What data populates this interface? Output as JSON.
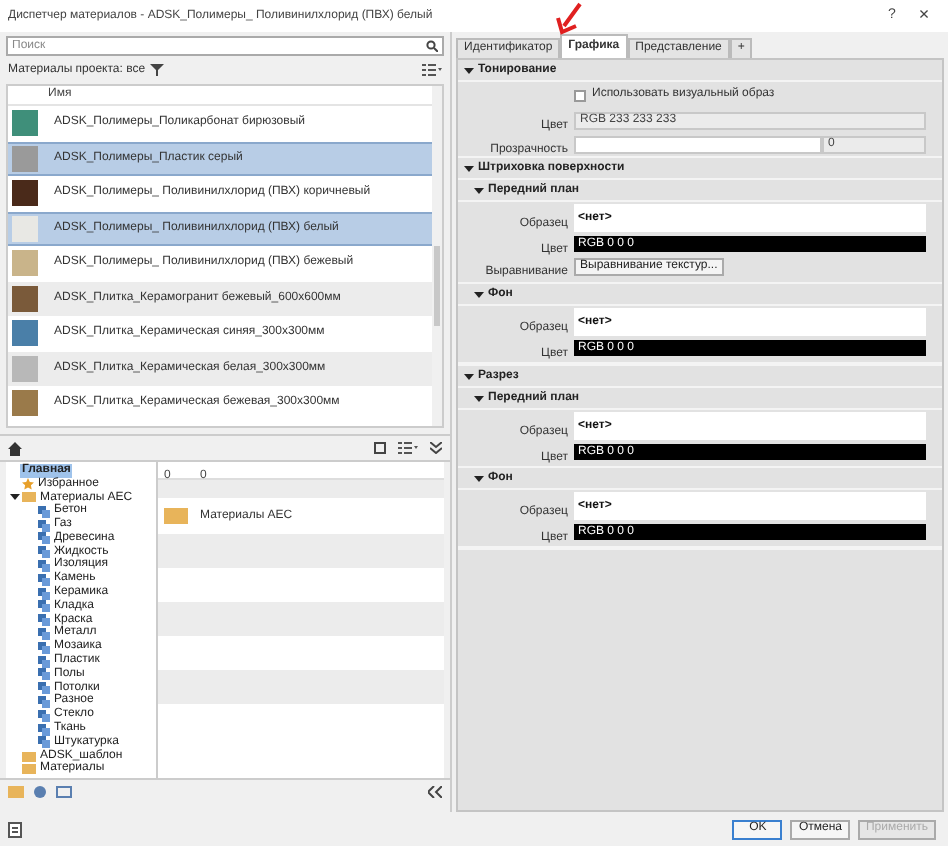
{
  "window": {
    "title": "Диспетчер материалов - ADSK_Полимеры_ Поливинилхлорид (ПВХ) белый",
    "help": "?",
    "close": "×"
  },
  "left": {
    "search": {
      "placeholder": "Поиск"
    },
    "filter_label": "Материалы проекта: все",
    "column": "Имя",
    "materials": [
      {
        "name": "ADSK_Полимеры_Поликарбонат бирюзовый",
        "color": "#3f8f7a",
        "selected": false
      },
      {
        "name": "ADSK_Полимеры_Пластик серый",
        "color": "#9a9a9a",
        "selected": true
      },
      {
        "name": "ADSK_Полимеры_ Поливинилхлорид (ПВХ) коричневый",
        "color": "#4a2a1a",
        "selected": false
      },
      {
        "name": "ADSK_Полимеры_ Поливинилхлорид (ПВХ) белый",
        "color": "#e8e8e4",
        "selected": true
      },
      {
        "name": "ADSK_Полимеры_ Поливинилхлорид (ПВХ) бежевый",
        "color": "#c9b48a",
        "selected": false
      },
      {
        "name": "ADSK_Плитка_Керамогранит бежевый_600х600мм",
        "color": "#7a5a3a",
        "selected": false
      },
      {
        "name": "ADSK_Плитка_Керамическая синяя_300х300мм",
        "color": "#4a7fa8",
        "selected": false
      },
      {
        "name": "ADSK_Плитка_Керамическая белая_300х300мм",
        "color": "#b8b8b8",
        "selected": false
      },
      {
        "name": "ADSK_Плитка_Керамическая бежевая_300х300мм",
        "color": "#9a7a4a",
        "selected": false
      }
    ],
    "tree": [
      {
        "label": "Главная",
        "selected": true,
        "kind": "root"
      },
      {
        "label": "Избранное",
        "selected": false,
        "kind": "star"
      },
      {
        "label": "Материалы AEC",
        "selected": false,
        "kind": "library",
        "expanded": true,
        "children": [
          {
            "label": "Бетон"
          },
          {
            "label": "Газ"
          },
          {
            "label": "Древесина"
          },
          {
            "label": "Жидкость"
          },
          {
            "label": "Изоляция"
          },
          {
            "label": "Камень"
          },
          {
            "label": "Керамика"
          },
          {
            "label": "Кладка"
          },
          {
            "label": "Краска"
          },
          {
            "label": "Металл"
          },
          {
            "label": "Мозаика"
          },
          {
            "label": "Пластик"
          },
          {
            "label": "Полы"
          },
          {
            "label": "Потолки"
          },
          {
            "label": "Разное"
          },
          {
            "label": "Стекло"
          },
          {
            "label": "Ткань"
          },
          {
            "label": "Штукатурка"
          }
        ]
      },
      {
        "label": "ADSK_шаблон",
        "selected": false,
        "kind": "library"
      },
      {
        "label": "Материалы",
        "selected": false,
        "kind": "library"
      }
    ],
    "browser_columns": [
      "0",
      "0"
    ],
    "browser_items": [
      {
        "label": "Материалы AEC"
      }
    ]
  },
  "tabs": [
    {
      "label": "Идентификатор",
      "selected": false
    },
    {
      "label": "Графика",
      "selected": true
    },
    {
      "label": "Представление",
      "selected": false
    },
    {
      "label": "+",
      "selected": false
    }
  ],
  "sections": [
    {
      "title": "Тонирование",
      "expanded": true,
      "rows": [
        {
          "kind": "checkbox",
          "label": "Использовать визуальный образ",
          "checked": false
        },
        {
          "kind": "field",
          "label": "Цвет",
          "value": "RGB 233 233 233"
        },
        {
          "kind": "slider",
          "label": "Прозрачность",
          "value": "0",
          "level": 0
        }
      ]
    },
    {
      "title": "Штриховка поверхности",
      "expanded": true,
      "subsections": [
        {
          "title": "Передний план",
          "expanded": true,
          "rows": [
            {
              "kind": "pattern",
              "label": "Образец",
              "value": "<нет>"
            },
            {
              "kind": "color",
              "label": "Цвет",
              "value": "RGB 0 0 0"
            },
            {
              "kind": "button",
              "label": "Выравнивание",
              "value": "Выравнивание текстур..."
            }
          ]
        },
        {
          "title": "Фон",
          "expanded": true,
          "rows": [
            {
              "kind": "pattern",
              "label": "Образец",
              "value": "<нет>"
            },
            {
              "kind": "color",
              "label": "Цвет",
              "value": "RGB 0 0 0"
            }
          ]
        }
      ]
    },
    {
      "title": "Разрез",
      "expanded": true,
      "subsections": [
        {
          "title": "Передний план",
          "expanded": true,
          "rows": [
            {
              "kind": "pattern",
              "label": "Образец",
              "value": "<нет>"
            },
            {
              "kind": "color",
              "label": "Цвет",
              "value": "RGB 0 0 0"
            }
          ]
        },
        {
          "title": "Фон",
          "expanded": true,
          "rows": [
            {
              "kind": "pattern",
              "label": "Образец",
              "value": "<нет>"
            },
            {
              "kind": "color",
              "label": "Цвет",
              "value": "RGB 0 0 0"
            }
          ]
        }
      ]
    }
  ],
  "buttons": [
    {
      "label": "OK",
      "kind": "primary",
      "disabled": false
    },
    {
      "label": "Отмена",
      "kind": "normal",
      "disabled": false
    },
    {
      "label": "Применить",
      "kind": "normal",
      "disabled": true
    }
  ]
}
